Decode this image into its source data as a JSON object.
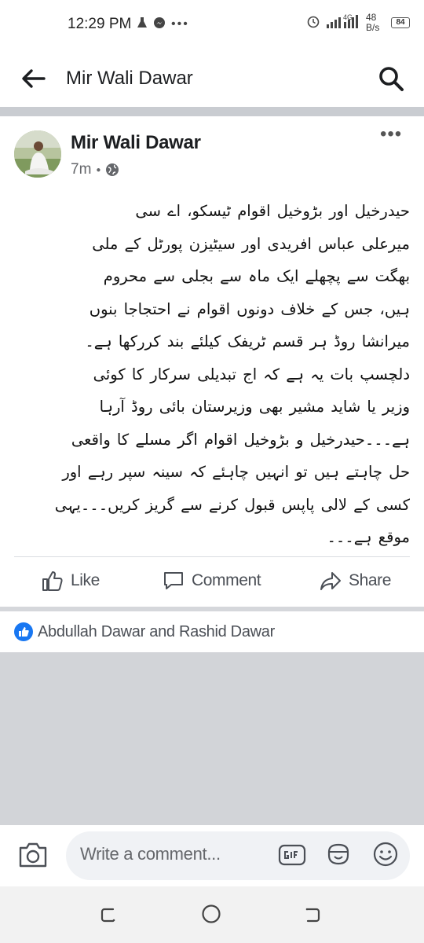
{
  "status_bar": {
    "time": "12:29 PM",
    "network": "4G",
    "data_rate": "48",
    "data_rate_unit": "B/s",
    "battery": "84"
  },
  "header": {
    "title": "Mir Wali Dawar"
  },
  "post": {
    "author": "Mir Wali Dawar",
    "time": "7m",
    "lines": [
      "حیدرخیل اور بڑوخیل اقوام ٹیسکو، اے سی",
      "میرعلی عباس افریدی اور سیٹیزن پورٹل کے ملی",
      "بھگت سے پچھلے ایک ماہ سے بجلی سے محروم",
      "ہیں، جس کے خلاف دونوں اقوام نے احتجاجا بنوں",
      "میرانشا روڈ ہر قسم ٹریفک کیلئے بند کررکھا ہے۔",
      "دلچسپ بات یہ ہے کہ اج تبدیلی سرکار کا کوئی",
      "وزیر یا شاید مشیر بھی وزیرستان بائی روڈ آرہا",
      "ہے۔۔۔حیدرخیل و بڑوخیل اقوام اگر مسلے کا واقعی",
      "حل چاہتے ہیں تو انہیں چاہئے کہ سینہ سپر رہے اور",
      "کسی کے لالی پاپس قبول کرنے سے گریز کریں۔۔۔یہی",
      "موقع ہے۔۔۔"
    ],
    "actions": {
      "like": "Like",
      "comment": "Comment",
      "share": "Share"
    },
    "reactions_text": "Abdullah Dawar and Rashid Dawar"
  },
  "composer": {
    "placeholder": "Write a comment..."
  },
  "colors": {
    "accent": "#1877f2",
    "divider": "#c9ccd1",
    "empty_area": "#d2d4d8"
  }
}
